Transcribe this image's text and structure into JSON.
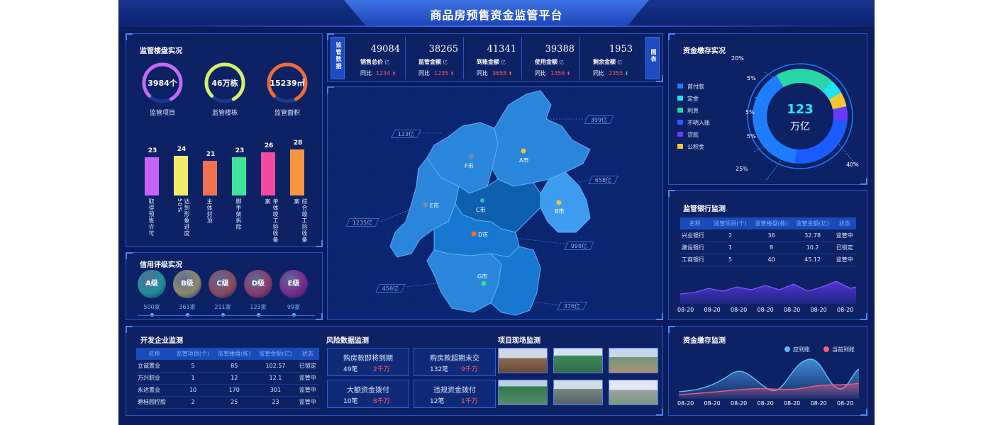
{
  "title": "商品房预售资金监管平台",
  "building_status": {
    "title": "监管楼盘实况",
    "gauges": [
      {
        "value": "3984个",
        "label": "监管项目",
        "color": "#c46bf0"
      },
      {
        "value": "46万栋",
        "label": "监管楼栋",
        "color": "#d4f06b"
      },
      {
        "value": "15239㎡",
        "label": "监管面积",
        "color": "#f06b35"
      }
    ],
    "bars": [
      {
        "value": 23,
        "label": "取得预售许可",
        "color": "#c864f5"
      },
      {
        "value": 24,
        "label": "达到形象进度50%",
        "color": "#f3ec6a"
      },
      {
        "value": 21,
        "label": "主体封顶",
        "color": "#f2714e"
      },
      {
        "value": 23,
        "label": "脚手架拆除",
        "color": "#3fe49a"
      },
      {
        "value": 26,
        "label": "单体竣工验收备案",
        "color": "#f24aa0"
      },
      {
        "value": 28,
        "label": "综合竣工验收备案",
        "color": "#f79640"
      }
    ]
  },
  "credit": {
    "title": "信用评级实况",
    "grades": [
      {
        "label": "A级",
        "count": "500家",
        "color": "#1f8f9a"
      },
      {
        "label": "B级",
        "count": "361家",
        "color": "#8d8a6a"
      },
      {
        "label": "C级",
        "count": "211家",
        "color": "#8a4a5a"
      },
      {
        "label": "D级",
        "count": "123家",
        "color": "#8a3a6a"
      },
      {
        "label": "E级",
        "count": "99家",
        "color": "#7a2a8a"
      }
    ]
  },
  "monitor": {
    "side_label": "监管数据",
    "chart_btn": "图表",
    "stats": [
      {
        "num": "49084",
        "label": "销售总价",
        "unit": "亿",
        "yoy_label": "同比",
        "yoy": "1234",
        "dir": "up"
      },
      {
        "num": "38265",
        "label": "监管金额",
        "unit": "亿",
        "yoy_label": "同比",
        "yoy": "1235",
        "dir": "up"
      },
      {
        "num": "41341",
        "label": "到账金额",
        "unit": "亿",
        "yoy_label": "同比",
        "yoy": "3658",
        "dir": "up"
      },
      {
        "num": "39388",
        "label": "使用金额",
        "unit": "亿",
        "yoy_label": "同比",
        "yoy": "1356",
        "dir": "up"
      },
      {
        "num": "1953",
        "label": "剩余金额",
        "unit": "亿",
        "yoy_label": "同比",
        "yoy": "2355",
        "dir": "down"
      }
    ]
  },
  "map": {
    "cities": [
      "A市",
      "B市",
      "C市",
      "D市",
      "E市",
      "F市",
      "G市"
    ],
    "tags": [
      "123亿",
      "399亿",
      "658亿",
      "1235亿",
      "998亿",
      "456亿",
      "376亿"
    ]
  },
  "deposit": {
    "title": "资金缴存实况",
    "center_value": "123",
    "center_unit": "万亿",
    "legend": [
      {
        "label": "首付款",
        "color": "#1e7cff"
      },
      {
        "label": "定金",
        "color": "#1ee4f0"
      },
      {
        "label": "利息",
        "color": "#2ad6a8"
      },
      {
        "label": "不明入账",
        "color": "#2a5cff"
      },
      {
        "label": "贷款",
        "color": "#6a3aff"
      },
      {
        "label": "公积金",
        "color": "#f5c531"
      }
    ],
    "percents": [
      "20%",
      "5%",
      "5%",
      "5%",
      "25%",
      "40%"
    ]
  },
  "bank": {
    "title": "监管银行监测",
    "columns": [
      "名称",
      "监管项目(个)",
      "监管楼盘(栋)",
      "监管金额(亿)",
      "状态"
    ],
    "rows": [
      [
        "兴业银行",
        "2",
        "36",
        "32.78",
        "监管中"
      ],
      [
        "建设银行",
        "1",
        "8",
        "10.2",
        "已锁定"
      ],
      [
        "工商银行",
        "5",
        "40",
        "45.12",
        "监管中"
      ]
    ],
    "x_ticks": [
      "08-20",
      "08-20",
      "08-20",
      "08-20",
      "08-20",
      "08-20",
      "08-20"
    ]
  },
  "developers": {
    "title": "开发企业监测",
    "columns": [
      "名称",
      "监管项目(个)",
      "监管楼盘(栋)",
      "监管金额(亿)",
      "状态"
    ],
    "rows": [
      [
        "立诚置业",
        "5",
        "85",
        "102.57",
        "已锁定"
      ],
      [
        "万兴职业",
        "1",
        "12",
        "12.1",
        "监管中"
      ],
      [
        "永达置业",
        "10",
        "170",
        "301",
        "监管中"
      ],
      [
        "碧桂园控股",
        "2",
        "25",
        "23",
        "监管中"
      ]
    ]
  },
  "risk": {
    "title": "风险数据监测",
    "items": [
      {
        "title": "购房款即将到期",
        "count": "49笔",
        "amount": "2千万"
      },
      {
        "title": "购房款超期未交",
        "count": "132笔",
        "amount": "9千万"
      },
      {
        "title": "大额资金拨付",
        "count": "10笔",
        "amount": "8千万"
      },
      {
        "title": "违规资金拨付",
        "count": "12笔",
        "amount": "1千万"
      }
    ]
  },
  "site": {
    "title": "项目现场监测"
  },
  "deposit_monitor": {
    "title": "资金缴存监测",
    "legend": [
      {
        "label": "应到账",
        "color": "#5ab8ff"
      },
      {
        "label": "当前到账",
        "color": "#ff5a7a"
      }
    ],
    "x_ticks": [
      "08-20",
      "08-20",
      "08-20",
      "08-20",
      "08-20",
      "08-20",
      "08-20"
    ]
  }
}
